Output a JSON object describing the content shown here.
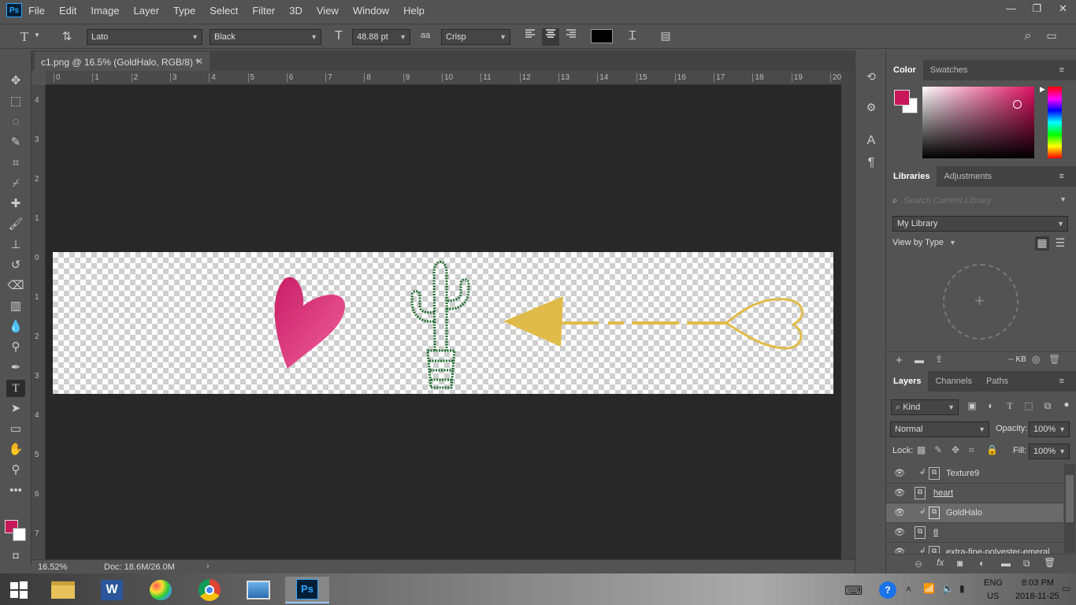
{
  "app": {
    "logo": "Ps"
  },
  "menu": [
    "File",
    "Edit",
    "Image",
    "Layer",
    "Type",
    "Select",
    "Filter",
    "3D",
    "View",
    "Window",
    "Help"
  ],
  "window_controls": {
    "minimize": "—",
    "restore": "❐",
    "close": "✕"
  },
  "options": {
    "font_family": "Lato",
    "font_style": "Black",
    "font_size": "48.88 pt",
    "aa_label": "aa",
    "antialias": "Crisp",
    "color_swatch": "#000000"
  },
  "document": {
    "tab_title": "c1.png @ 16.5% (GoldHalo, RGB/8) *",
    "zoom": "16.52%",
    "doc_size": "Doc: 18.6M/26.0M"
  },
  "rulers": {
    "top": [
      "0",
      "1",
      "2",
      "3",
      "4",
      "5",
      "6",
      "7",
      "8",
      "9",
      "10",
      "11",
      "12",
      "13",
      "14",
      "15",
      "16",
      "17",
      "18",
      "19",
      "20"
    ],
    "left": [
      "4",
      "3",
      "2",
      "1",
      "0",
      "1",
      "2",
      "3",
      "4",
      "5",
      "6",
      "7"
    ]
  },
  "colors": {
    "foreground": "#c8185a",
    "background": "#ffffff",
    "accent": "#31a8ff",
    "heart": "#d8317a",
    "cactus": "#1a6b2a",
    "gold": "#e0bb4a"
  },
  "color_panel": {
    "tabs": [
      "Color",
      "Swatches"
    ]
  },
  "libraries_panel": {
    "tabs": [
      "Libraries",
      "Adjustments"
    ],
    "search_placeholder": "Search Current Library",
    "library": "My Library",
    "view_by": "View by Type",
    "kb": "-- KB"
  },
  "layers_panel": {
    "tabs": [
      "Layers",
      "Channels",
      "Paths"
    ],
    "filter_kind": "Kind",
    "blend_mode": "Normal",
    "opacity_label": "Opacity:",
    "opacity": "100%",
    "lock_label": "Lock:",
    "fill_label": "Fill:",
    "fill": "100%",
    "layers": [
      {
        "name": "Texture9",
        "clipped": true,
        "selected": false
      },
      {
        "name": "heart",
        "clipped": false,
        "selected": false
      },
      {
        "name": "GoldHalo",
        "clipped": true,
        "selected": true
      },
      {
        "name": "8",
        "clipped": false,
        "selected": false
      },
      {
        "name": "extra-fine-polyester-emeral",
        "clipped": true,
        "selected": false
      }
    ]
  },
  "taskbar": {
    "lang": "ENG",
    "region": "US",
    "time": "8:03 PM",
    "date": "2018-11-25"
  }
}
